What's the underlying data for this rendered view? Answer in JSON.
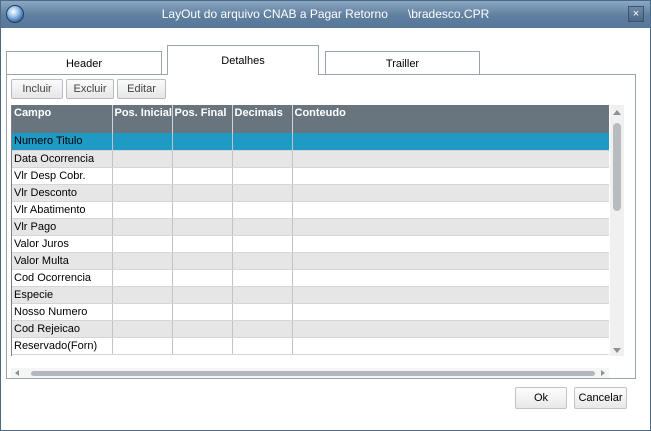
{
  "window": {
    "title": "LayOut do arquivo CNAB a Pagar Retorno      \\bradesco.CPR",
    "close_label": "×"
  },
  "tabs": [
    {
      "label": "Header"
    },
    {
      "label": "Detalhes",
      "active": true
    },
    {
      "label": "Trailler"
    }
  ],
  "toolbar": {
    "incluir_label": "Incluir",
    "excluir_label": "Excluir",
    "editar_label": "Editar"
  },
  "grid": {
    "columns": [
      "Campo",
      "Pos. Inicial",
      "Pos. Final",
      "Decimais",
      "Conteudo"
    ],
    "rows": [
      [
        "Numero Titulo",
        "",
        "",
        "",
        ""
      ],
      [
        "Data Ocorrencia",
        "",
        "",
        "",
        ""
      ],
      [
        "Vlr Desp Cobr.",
        "",
        "",
        "",
        ""
      ],
      [
        "Vlr Desconto",
        "",
        "",
        "",
        ""
      ],
      [
        "Vlr Abatimento",
        "",
        "",
        "",
        ""
      ],
      [
        "Vlr Pago",
        "",
        "",
        "",
        ""
      ],
      [
        "Valor Juros",
        "",
        "",
        "",
        ""
      ],
      [
        "Valor Multa",
        "",
        "",
        "",
        ""
      ],
      [
        "Cod Ocorrencia",
        "",
        "",
        "",
        ""
      ],
      [
        "Especie",
        "",
        "",
        "",
        ""
      ],
      [
        "Nosso Numero",
        "",
        "",
        "",
        ""
      ],
      [
        "Cod Rejeicao",
        "",
        "",
        "",
        ""
      ],
      [
        "Reservado(Forn)",
        "",
        "",
        "",
        ""
      ]
    ],
    "selected_row": 0
  },
  "footer": {
    "ok_label": "Ok",
    "cancel_label": "Cancelar"
  },
  "colors": {
    "selection": "#1f9ac4",
    "header_bg": "#68757e",
    "titlebar": "#5f7f9f"
  }
}
